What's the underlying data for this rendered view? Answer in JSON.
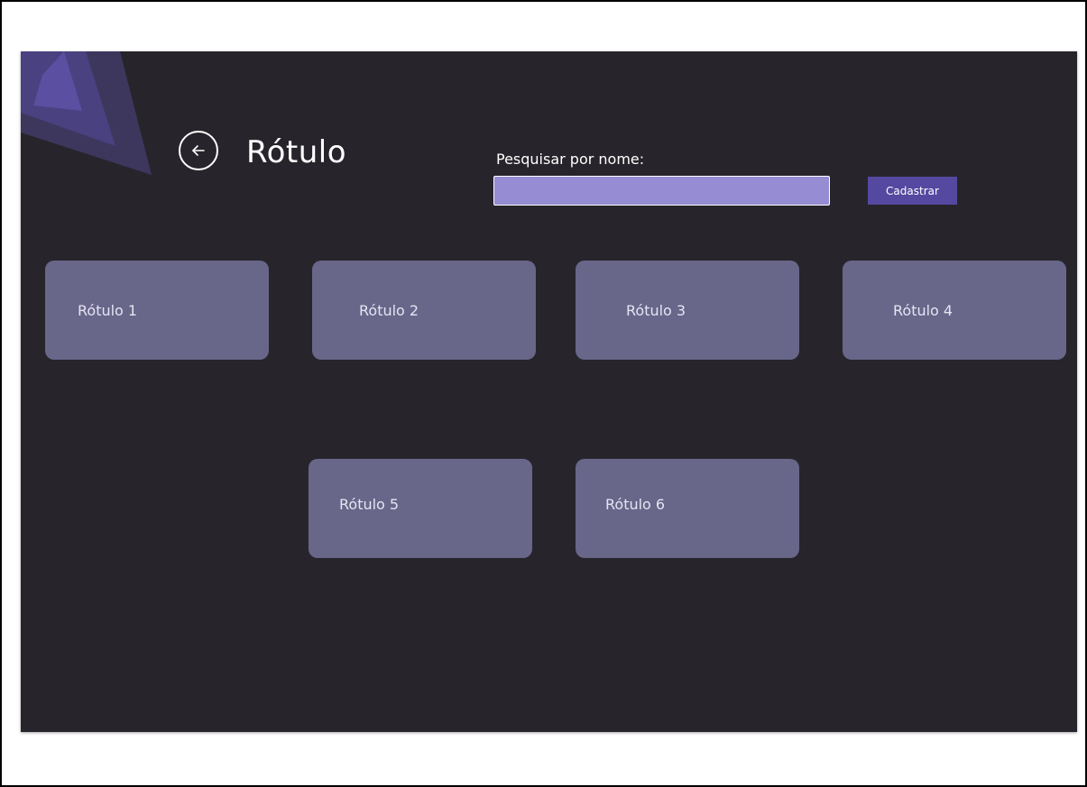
{
  "header": {
    "title": "Rótulo",
    "back_icon": "arrow-left-icon"
  },
  "search": {
    "label": "Pesquisar por nome:",
    "value": "",
    "placeholder": ""
  },
  "actions": {
    "register_label": "Cadastrar"
  },
  "cards": [
    {
      "label": "Rótulo 1"
    },
    {
      "label": "Rótulo 2"
    },
    {
      "label": "Rótulo 3"
    },
    {
      "label": "Rótulo 4"
    },
    {
      "label": "Rótulo 5"
    },
    {
      "label": "Rótulo 6"
    }
  ],
  "colors": {
    "background": "#27252b",
    "card": "#686689",
    "input": "#958cd3",
    "button": "#5548a0",
    "accent": "#4a3f87"
  }
}
